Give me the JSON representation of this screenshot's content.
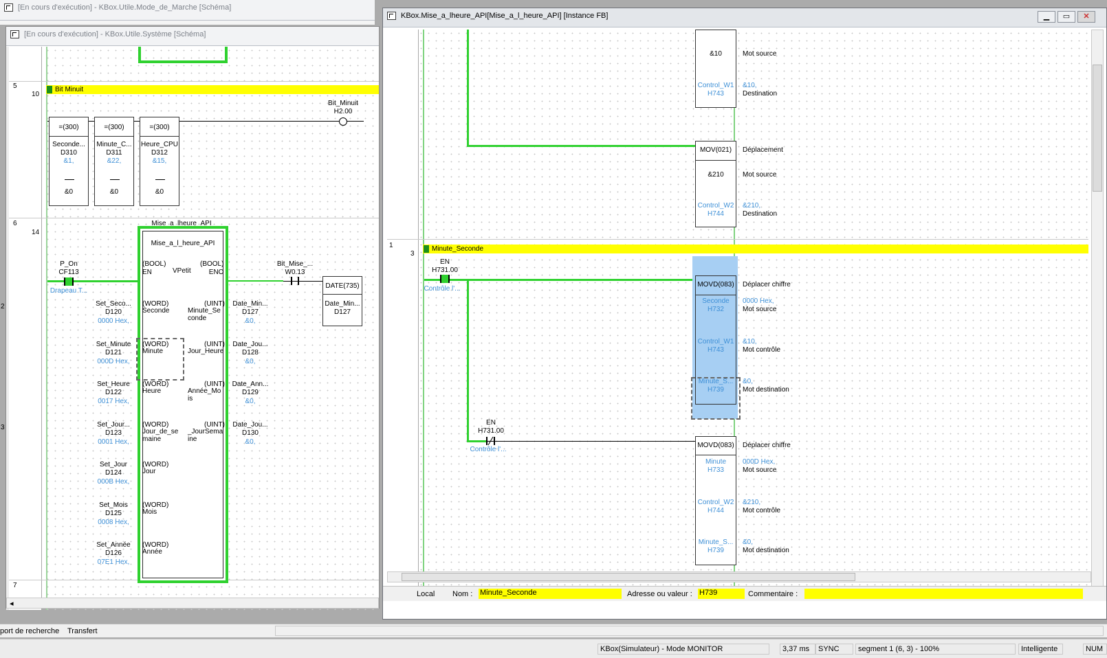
{
  "back_window": {
    "title": "[En cours d'exécution] - KBox.Utile.Mode_de_Marche [Schéma]"
  },
  "left_window": {
    "title": "[En cours d'exécution] - KBox.Utile.Système [Schéma]",
    "rungs": {
      "r5": {
        "num": "5",
        "step": "10",
        "comment": "Bit Minuit"
      },
      "r6": {
        "num": "6",
        "step": "14"
      },
      "r7": {
        "num": "7"
      }
    },
    "side_marks": [
      "2",
      "3"
    ],
    "cmp_blocks": [
      {
        "op": "=(300)",
        "name": "Seconde...",
        "addr": "D310",
        "val": "&1,",
        "c": "&0"
      },
      {
        "op": "=(300)",
        "name": "Minute_C...",
        "addr": "D311",
        "val": "&22,",
        "c": "&0"
      },
      {
        "op": "=(300)",
        "name": "Heure_CPU",
        "addr": "D312",
        "val": "&15,",
        "c": "&0"
      }
    ],
    "coil": {
      "name": "Bit_Minuit",
      "addr": "H2.00"
    },
    "p_on": {
      "name": "P_On",
      "addr": "CF113",
      "comment": "Drapeau T..."
    },
    "fb": {
      "instance": "Mise_a_lheure_API",
      "type": "Mise_a_l_heure_API",
      "en_in": "(BOOL)\nEN",
      "vpetit": "VPetit",
      "eno_out": "(BOOL)\nENO",
      "inputs": [
        {
          "t": "(WORD)",
          "n": "Seconde",
          "var": "Set_Seco...",
          "addr": "D120",
          "val": "0000 Hex,"
        },
        {
          "t": "(WORD)",
          "n": "Minute",
          "var": "Set_Minute",
          "addr": "D121",
          "val": "000D Hex,"
        },
        {
          "t": "(WORD)",
          "n": "Heure",
          "var": "Set_Heure",
          "addr": "D122",
          "val": "0017 Hex,"
        },
        {
          "t": "(WORD)",
          "n": "Jour_de_se\nmaine",
          "var": "Set_Jour...",
          "addr": "D123",
          "val": "0001 Hex,"
        },
        {
          "t": "(WORD)",
          "n": "Jour",
          "var": "Set_Jour",
          "addr": "D124",
          "val": "000B Hex,"
        },
        {
          "t": "(WORD)",
          "n": "Mois",
          "var": "Set_Mois",
          "addr": "D125",
          "val": "0008 Hex,"
        },
        {
          "t": "(WORD)",
          "n": "Année",
          "var": "Set_Année",
          "addr": "D126",
          "val": "07E1 Hex,"
        }
      ],
      "outputs": [
        {
          "t": "(UINT)",
          "n": "Minute_Se\nconde",
          "var": "Date_Min...",
          "addr": "D127",
          "val": "&0,"
        },
        {
          "t": "(UINT)",
          "n": "Jour_Heure",
          "var": "Date_Jou...",
          "addr": "D128",
          "val": "&0,"
        },
        {
          "t": "(UINT)",
          "n": "Année_Mo\nis",
          "var": "Date_Ann...",
          "addr": "D129",
          "val": "&0,"
        },
        {
          "t": "(UINT)",
          "n": "_JourSema\nine",
          "var": "Date_Jou...",
          "addr": "D130",
          "val": "&0,"
        }
      ]
    },
    "bit_mise": {
      "name": "Bit_Mise_...",
      "addr": "W0.13"
    },
    "date_block": {
      "op": "DATE(735)",
      "name": "Date_Min...",
      "addr": "D127"
    },
    "tabs": [
      "port de recherche",
      "Transfert"
    ]
  },
  "right_window": {
    "title": "KBox.Mise_a_lheure_API[Mise_a_l_heure_API] [Instance FB]",
    "controls": [
      "▁",
      "▭",
      "✕"
    ],
    "top_block1": {
      "val": "&10",
      "dname": "Control_W1",
      "daddr": "H743",
      "c1": "Mot source",
      "c2": "&10,",
      "c3": "Destination"
    },
    "mov_block": {
      "op": "MOV(021)",
      "op_c": "Déplacement",
      "val": "&210",
      "val_c": "Mot source",
      "dname": "Control_W2",
      "daddr": "H744",
      "d_v": "&210,",
      "d_c": "Destination"
    },
    "rung1": {
      "num": "1",
      "step": "3",
      "comment": "Minute_Seconde"
    },
    "en1": {
      "name": "EN",
      "addr": "H731.00",
      "comment": "Contrôle l'..."
    },
    "en2": {
      "name": "EN",
      "addr": "H731.00",
      "comment": "Contrôle l'..."
    },
    "movd1": {
      "op": "MOVD(083)",
      "op_c": "Déplacer chiffre",
      "rows": [
        {
          "name": "Seconde",
          "addr": "H732",
          "v": "0000 Hex,",
          "c": "Mot source"
        },
        {
          "name": "Control_W1",
          "addr": "H743",
          "v": "&10,",
          "c": "Mot contrôle"
        },
        {
          "name": "Minute_S...",
          "addr": "H739",
          "v": "&0,",
          "c": "Mot destination"
        }
      ]
    },
    "movd2": {
      "op": "MOVD(083)",
      "op_c": "Déplacer chiffre",
      "rows": [
        {
          "name": "Minute",
          "addr": "H733",
          "v": "000D Hex,",
          "c": "Mot source"
        },
        {
          "name": "Control_W2",
          "addr": "H744",
          "v": "&210,",
          "c": "Mot contrôle"
        },
        {
          "name": "Minute_S...",
          "addr": "H739",
          "v": "&0,",
          "c": "Mot destination"
        }
      ]
    },
    "bar": {
      "scope": "Local",
      "name_label": "Nom :",
      "name_value": "Minute_Seconde",
      "addr_label": "Adresse ou valeur :",
      "addr_value": "H739",
      "comment_label": "Commentaire :",
      "comment_value": ""
    }
  },
  "status": {
    "mode": "KBox(Simulateur) - Mode MONITOR",
    "cycle": "3,37 ms",
    "sync": "SYNC",
    "segment": "segment 1 (6, 3)  - 100%",
    "input": "Intelligente",
    "num": "NUM"
  }
}
